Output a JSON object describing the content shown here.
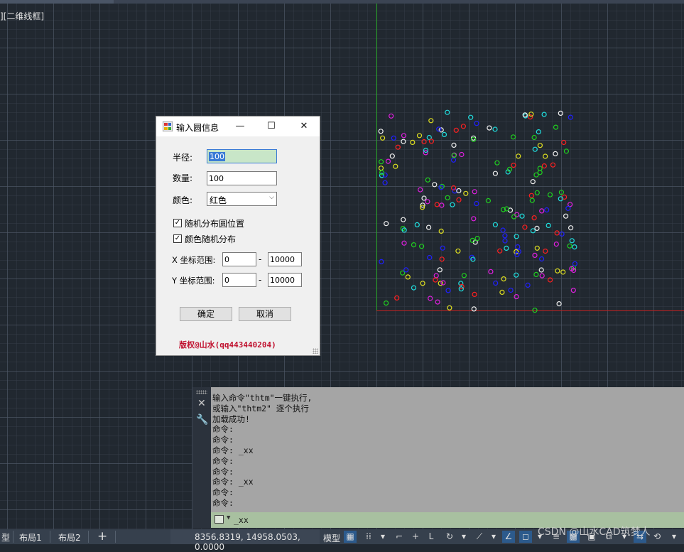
{
  "viewport": {
    "view_label": "][二维线框]"
  },
  "dialog": {
    "title": "输入圆信息",
    "minimize": "—",
    "maximize": "☐",
    "close": "✕",
    "radius_label": "半径:",
    "radius_value": "100",
    "count_label": "数量:",
    "count_value": "100",
    "color_label": "颜色:",
    "color_value": "红色",
    "random_position_label": "随机分布圆位置",
    "random_position_checked": true,
    "random_color_label": "颜色随机分布",
    "random_color_checked": true,
    "x_range_label": "X 坐标范围:",
    "x_min": "0",
    "x_max": "10000",
    "y_range_label": "Y 坐标范围:",
    "y_min": "0",
    "y_max": "10000",
    "range_dash": "-",
    "ok_label": "确定",
    "cancel_label": "取消",
    "copyright": "版权@山水(qq443440204)"
  },
  "command": {
    "history": [
      "输入命令\"thtm\"一键执行,",
      "或输入\"thtm2\" 逐个执行",
      "加载成功!",
      "命令:",
      "命令:",
      "命令: _xx",
      "命令:",
      "命令:",
      "命令: _xx",
      "命令:",
      "命令:"
    ],
    "input": "_xx"
  },
  "statusbar": {
    "layout_tabs": [
      "布局1",
      "布局2"
    ],
    "add_tab": "+",
    "coordinates": "8356.8319, 14958.0503, 0.0000",
    "model_label": "模型"
  },
  "watermark": "CSDN @山水CAD筑梦人",
  "circle_colors": {
    "red": "#ff2020",
    "yellow": "#e0e020",
    "blue": "#2020ff",
    "green": "#20d020",
    "cyan": "#20e0e0",
    "magenta": "#e020e0",
    "white": "#f0f0f0"
  }
}
